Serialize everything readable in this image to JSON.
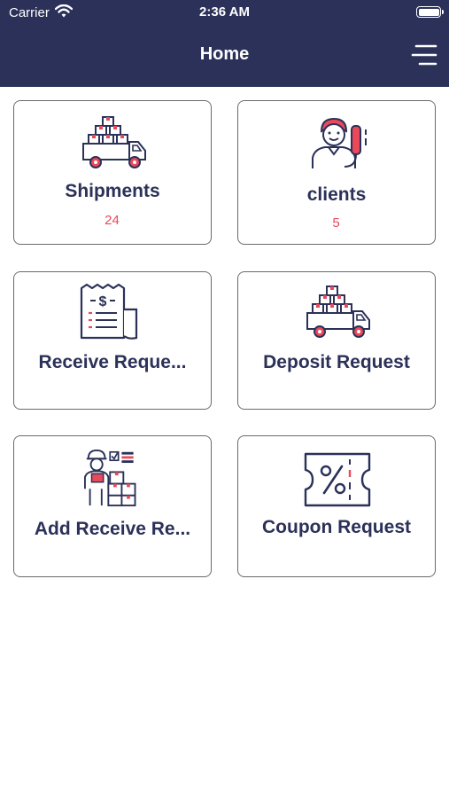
{
  "status_bar": {
    "carrier": "Carrier",
    "time": "2:36 AM"
  },
  "header": {
    "title": "Home"
  },
  "colors": {
    "nav": "#2b3158",
    "accent": "#e9495a",
    "border": "#6a6a6a"
  },
  "cards": [
    {
      "label": "Shipments",
      "count": "24",
      "icon": "delivery-truck-icon"
    },
    {
      "label": "clients",
      "count": "5",
      "icon": "customer-support-icon"
    },
    {
      "label": "Receive Reque...",
      "icon": "receipt-icon"
    },
    {
      "label": "Deposit Request",
      "icon": "delivery-truck-icon"
    },
    {
      "label": "Add Receive Re...",
      "icon": "courier-packages-icon"
    },
    {
      "label": "Coupon Request",
      "icon": "coupon-icon"
    }
  ]
}
